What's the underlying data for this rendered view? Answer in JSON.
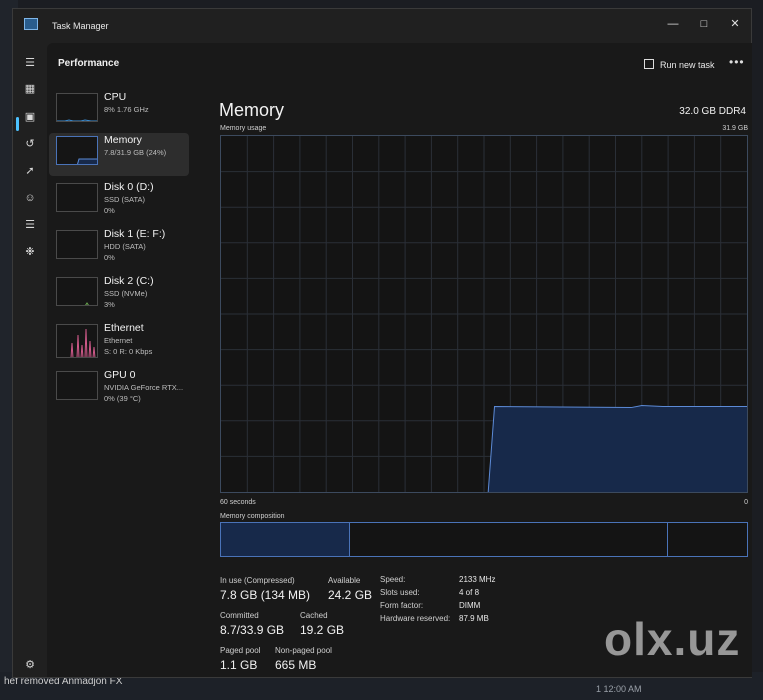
{
  "window": {
    "title": "Task Manager"
  },
  "header": {
    "page_title": "Performance",
    "run_new_task": "Run new task"
  },
  "resources": [
    {
      "name": "CPU",
      "line1": "8%  1.76 GHz",
      "line2": "",
      "line3": ""
    },
    {
      "name": "Memory",
      "line1": "7.8/31.9 GB (24%)",
      "line2": "",
      "line3": ""
    },
    {
      "name": "Disk 0 (D:)",
      "line1": "SSD (SATA)",
      "line2": "0%",
      "line3": ""
    },
    {
      "name": "Disk 1 (E: F:)",
      "line1": "HDD (SATA)",
      "line2": "0%",
      "line3": ""
    },
    {
      "name": "Disk 2 (C:)",
      "line1": "SSD (NVMe)",
      "line2": "3%",
      "line3": ""
    },
    {
      "name": "Ethernet",
      "line1": "Ethernet",
      "line2": "S: 0  R: 0 Kbps",
      "line3": ""
    },
    {
      "name": "GPU 0",
      "line1": "NVIDIA GeForce RTX...",
      "line2": "0%  (39 °C)",
      "line3": ""
    }
  ],
  "memory": {
    "title": "Memory",
    "spec": "32.0 GB DDR4",
    "usage_label": "Memory usage",
    "usage_max": "31.9 GB",
    "time_label": "60 seconds",
    "time_end": "0",
    "composition_label": "Memory composition",
    "stats": {
      "in_use_label": "In use (Compressed)",
      "in_use": "7.8 GB (134 MB)",
      "available_label": "Available",
      "available": "24.2 GB",
      "committed_label": "Committed",
      "committed": "8.7/33.9 GB",
      "cached_label": "Cached",
      "cached": "19.2 GB",
      "paged_label": "Paged pool",
      "paged": "1.1 GB",
      "nonpaged_label": "Non-paged pool",
      "nonpaged": "665 MB"
    },
    "specs": [
      {
        "label": "Speed:",
        "value": "2133 MHz"
      },
      {
        "label": "Slots used:",
        "value": "4 of 8"
      },
      {
        "label": "Form factor:",
        "value": "DIMM"
      },
      {
        "label": "Hardware reserved:",
        "value": "87.9 MB"
      }
    ],
    "usage_fraction": 0.24,
    "composition": {
      "in_use_fraction": 0.245,
      "standby_end_fraction": 0.85
    },
    "colors": {
      "accent": "#4a73b8",
      "fill": "#17294a",
      "line": "#5c8ad6"
    }
  },
  "background": {
    "bottom_text": "hef removed Anmadjon FX",
    "bottom_right": "1  12:00 AM",
    "watermark": "olx.uz"
  }
}
